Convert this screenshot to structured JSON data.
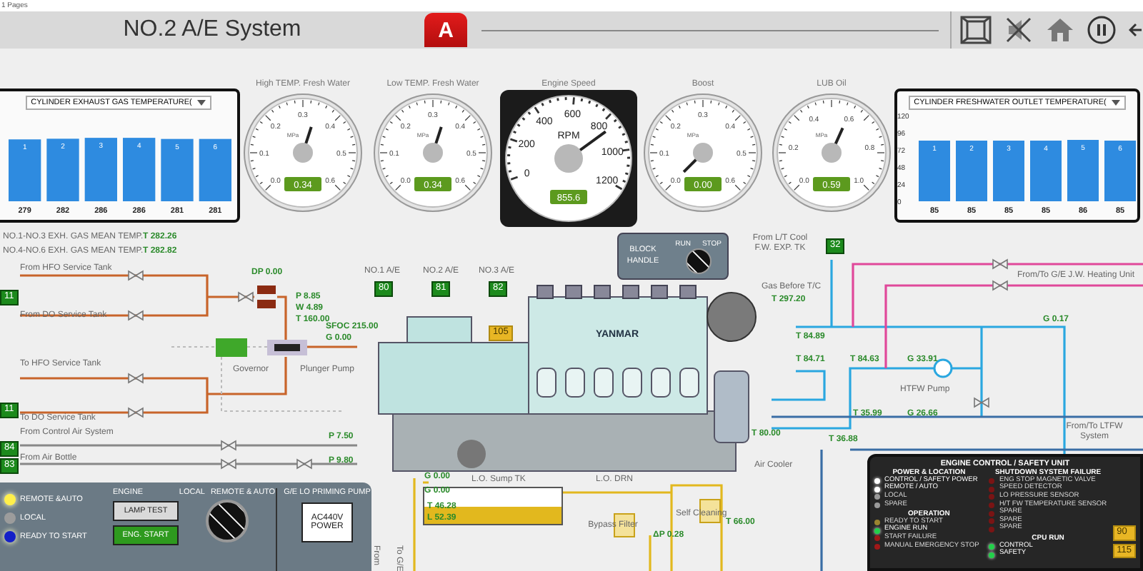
{
  "page_label": "1 Pages",
  "header": {
    "title": "NO.2 A/E System",
    "alarm_glyph": "A"
  },
  "charts": [
    {
      "selector": "CYLINDER EXHAUST GAS TEMPERATURE(",
      "chart_data": {
        "type": "bar",
        "categories": [
          "1",
          "2",
          "3",
          "4",
          "5",
          "6"
        ],
        "values": [
          279,
          282,
          286,
          286,
          281,
          281
        ],
        "data_labels": true
      }
    },
    {
      "selector": "CYLINDER FRESHWATER OUTLET TEMPERATURE(",
      "chart_data": {
        "type": "bar",
        "categories": [
          "1",
          "2",
          "3",
          "4",
          "5",
          "6"
        ],
        "values": [
          85,
          85,
          85,
          85,
          86,
          85
        ],
        "ylim": [
          0,
          120
        ],
        "yticks": [
          0,
          24,
          48,
          72,
          96,
          120
        ],
        "data_labels": true
      }
    }
  ],
  "gauges": [
    {
      "kind": "dial",
      "label": "High TEMP. Fresh Water",
      "unit": "MPa",
      "scale": [
        "0.0",
        "0.1",
        "0.2",
        "0.3",
        "0.4",
        "0.5",
        "0.6"
      ],
      "reading": "0.34"
    },
    {
      "kind": "dial",
      "label": "Low TEMP. Fresh Water",
      "unit": "MPa",
      "scale": [
        "0.0",
        "0.1",
        "0.2",
        "0.3",
        "0.4",
        "0.5",
        "0.6"
      ],
      "reading": "0.34"
    },
    {
      "kind": "speed",
      "label": "Engine Speed",
      "unit": "RPM",
      "scale": [
        "0",
        "200",
        "400",
        "600",
        "800",
        "1000",
        "1200"
      ],
      "reading": "855.6"
    },
    {
      "kind": "dial",
      "label": "Boost",
      "unit": "MPa",
      "scale": [
        "0.0",
        "0.1",
        "0.2",
        "0.3",
        "0.4",
        "0.5",
        "0.6"
      ],
      "reading": "0.00"
    },
    {
      "kind": "dial",
      "label": "LUB Oil",
      "unit": "MPa",
      "scale": [
        "0.0",
        "0.2",
        "0.4",
        "0.6",
        "0.8",
        "1.0"
      ],
      "reading": "0.59"
    }
  ],
  "diagram": {
    "labels": [
      {
        "kind": "note",
        "text": "NO.1-NO.3 EXH. GAS MEAN TEMP."
      },
      {
        "kind": "reading",
        "text": "T 282.26"
      },
      {
        "kind": "note",
        "text": "NO.4-NO.6 EXH. GAS MEAN TEMP."
      },
      {
        "kind": "reading",
        "text": "T 282.82"
      },
      {
        "kind": "note",
        "text": "From HFO Service Tank"
      },
      {
        "kind": "note",
        "text": "From DO Service Tank"
      },
      {
        "kind": "note",
        "text": "To HFO Service Tank"
      },
      {
        "kind": "note",
        "text": "To DO Service Tank"
      },
      {
        "kind": "note",
        "text": "From Control Air System"
      },
      {
        "kind": "note",
        "text": "From Air Bottle"
      },
      {
        "kind": "reading",
        "text": "DP 0.00"
      },
      {
        "kind": "reading",
        "text": "P 8.85"
      },
      {
        "kind": "reading",
        "text": "W 4.89"
      },
      {
        "kind": "reading",
        "text": "T 160.00"
      },
      {
        "kind": "reading",
        "text": "SFOC 215.00"
      },
      {
        "kind": "reading",
        "text": "G 0.00"
      },
      {
        "kind": "note",
        "text": "Governor"
      },
      {
        "kind": "note",
        "text": "Plunger Pump"
      },
      {
        "kind": "reading",
        "text": "P 7.50"
      },
      {
        "kind": "reading",
        "text": "P 9.80"
      },
      {
        "kind": "note",
        "text": "NO.1 A/E"
      },
      {
        "kind": "note",
        "text": "NO.2 A/E"
      },
      {
        "kind": "note",
        "text": "NO.3 A/E"
      },
      {
        "kind": "wrap",
        "text": "From L/T Cool F.W. EXP. TK"
      },
      {
        "kind": "note",
        "text": "Gas Before T/C"
      },
      {
        "kind": "reading",
        "text": "T 297.20"
      },
      {
        "kind": "reading",
        "text": "T 84.89"
      },
      {
        "kind": "reading",
        "text": "T 84.71"
      },
      {
        "kind": "reading",
        "text": "T 84.63"
      },
      {
        "kind": "reading",
        "text": "G 33.91"
      },
      {
        "kind": "note",
        "text": "HTFW Pump"
      },
      {
        "kind": "reading",
        "text": "G 0.17"
      },
      {
        "kind": "note",
        "text": "From/To G/E J.W. Heating Unit"
      },
      {
        "kind": "reading",
        "text": "T 35.99"
      },
      {
        "kind": "reading",
        "text": "G 26.66"
      },
      {
        "kind": "reading",
        "text": "T 80.00"
      },
      {
        "kind": "reading",
        "text": "T 36.88"
      },
      {
        "kind": "wrap",
        "text": "From/To LTFW System"
      },
      {
        "kind": "note",
        "text": "Air Cooler"
      },
      {
        "kind": "reading",
        "text": "G 0.00"
      },
      {
        "kind": "reading",
        "text": "G 0.00"
      },
      {
        "kind": "note",
        "text": "L.O. Sump TK"
      },
      {
        "kind": "note",
        "text": "L.O. DRN"
      },
      {
        "kind": "wrap",
        "text": "Bypass Filter"
      },
      {
        "kind": "reading",
        "text": "ΔP 0.28"
      },
      {
        "kind": "note",
        "text": "Self Cleaning"
      },
      {
        "kind": "reading",
        "text": "T 66.00"
      },
      {
        "kind": "vertical",
        "text": "From"
      },
      {
        "kind": "vertical",
        "text": "To G/E"
      },
      {
        "kind": "reading",
        "text": "T 46.28"
      },
      {
        "kind": "reading",
        "text": "L 52.39"
      }
    ],
    "badges": [
      {
        "kind": "green",
        "text": "11"
      },
      {
        "kind": "green",
        "text": "11"
      },
      {
        "kind": "green",
        "text": "84"
      },
      {
        "kind": "green",
        "text": "83"
      },
      {
        "kind": "green",
        "text": "80"
      },
      {
        "kind": "green",
        "text": "81"
      },
      {
        "kind": "green",
        "text": "82"
      },
      {
        "kind": "green",
        "text": "32"
      },
      {
        "kind": "yellow",
        "text": "105"
      }
    ],
    "engine_brand": "YANMAR",
    "block_handle": {
      "label": "BLOCK HANDLE",
      "run": "RUN",
      "stop": "STOP"
    }
  },
  "local_panel": {
    "lamps": [
      {
        "label": "REMOTE &AUTO",
        "on": true,
        "color": "#fff04a"
      },
      {
        "label": "LOCAL",
        "on": false,
        "color": "#9c9c9c"
      },
      {
        "label": "READY TO START",
        "on": true,
        "color": "#1420c8"
      }
    ],
    "engine_label": "ENGINE",
    "buttons": [
      {
        "kind": "plain",
        "label": "LAMP TEST"
      },
      {
        "kind": "start",
        "label": "ENG. START"
      }
    ],
    "switch_labels": [
      "LOCAL",
      "REMOTE & AUTO"
    ],
    "pump": {
      "title": "G/E LO PRIMING PUMP",
      "power": "AC440V POWER"
    }
  },
  "safety_unit": {
    "title": "ENGINE CONTROL / SAFETY UNIT",
    "sections": [
      {
        "title": "POWER & LOCATION",
        "items": [
          {
            "label": "CONTROL / SAFETY POWER",
            "on": true,
            "color": "#ffffff"
          },
          {
            "label": "REMOTE / AUTO",
            "on": true,
            "color": "#ffffff"
          },
          {
            "label": "LOCAL",
            "on": false,
            "color": "#9a9a9a"
          },
          {
            "label": "SPARE",
            "on": false,
            "color": "#9a9a9a"
          }
        ]
      },
      {
        "title": "OPERATION",
        "items": [
          {
            "label": "READY TO START",
            "on": false,
            "color": "#9a8430"
          },
          {
            "label": "ENGINE RUN",
            "on": true,
            "color": "#22d04a"
          },
          {
            "label": "START FAILURE",
            "on": false,
            "color": "#a01818"
          },
          {
            "label": "MANUAL EMERGENCY STOP",
            "on": false,
            "color": "#a01818"
          }
        ]
      },
      {
        "title": "SHUTDOWN SYSTEM FAILURE",
        "items": [
          {
            "label": "ENG STOP MAGNETIC VALVE",
            "on": false,
            "color": "#7a1414"
          },
          {
            "label": "SPEED DETECTOR",
            "on": false,
            "color": "#7a1414"
          },
          {
            "label": "LO PRESSURE SENSOR",
            "on": false,
            "color": "#7a1414"
          },
          {
            "label": "H/T FW TEMPERATURE SENSOR",
            "on": false,
            "color": "#7a1414"
          },
          {
            "label": "SPARE",
            "on": false,
            "color": "#7a1414"
          },
          {
            "label": "SPARE",
            "on": false,
            "color": "#7a1414"
          },
          {
            "label": "SPARE",
            "on": false,
            "color": "#7a1414"
          }
        ]
      },
      {
        "title": "CPU RUN",
        "items": [
          {
            "label": "CONTROL",
            "on": true,
            "color": "#22d04a"
          },
          {
            "label": "SAFETY",
            "on": true,
            "color": "#22d04a"
          }
        ]
      }
    ],
    "badges": [
      "90",
      "115"
    ]
  }
}
